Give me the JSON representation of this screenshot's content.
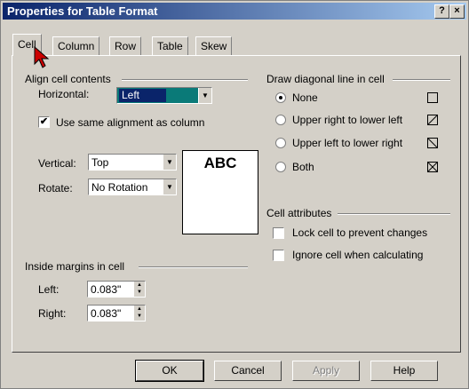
{
  "window": {
    "title": "Properties for Table Format",
    "help_btn": "?",
    "close_btn": "×"
  },
  "tabs": [
    "Cell",
    "Column",
    "Row",
    "Table",
    "Skew"
  ],
  "align": {
    "group_label": "Align cell contents",
    "horizontal_label": "Horizontal:",
    "horizontal_value": "Left",
    "same_alignment_label": "Use  same alignment as column",
    "same_alignment_checked": true,
    "vertical_label": "Vertical:",
    "vertical_value": "Top",
    "rotate_label": "Rotate:",
    "rotate_value": "No Rotation",
    "preview_text": "ABC"
  },
  "margins": {
    "group_label": "Inside margins in cell",
    "left_label": "Left:",
    "left_value": "0.083\"",
    "right_label": "Right:",
    "right_value": "0.083\""
  },
  "diagonal": {
    "group_label": "Draw diagonal line in cell",
    "options": [
      "None",
      "Upper right to lower left",
      "Upper left to lower right",
      "Both"
    ],
    "selected": "None",
    "icons": [
      "cell-none-icon",
      "cell-diag-urll-icon",
      "cell-diag-ullr-icon",
      "cell-diag-both-icon"
    ]
  },
  "attributes": {
    "group_label": "Cell attributes",
    "lock_label": "Lock cell to prevent changes",
    "ignore_label": "Ignore cell when calculating"
  },
  "buttons": {
    "ok": "OK",
    "cancel": "Cancel",
    "apply": "Apply",
    "help": "Help"
  },
  "colors": {
    "titlebar": "#0a246a",
    "pointer": "#cc0000"
  }
}
